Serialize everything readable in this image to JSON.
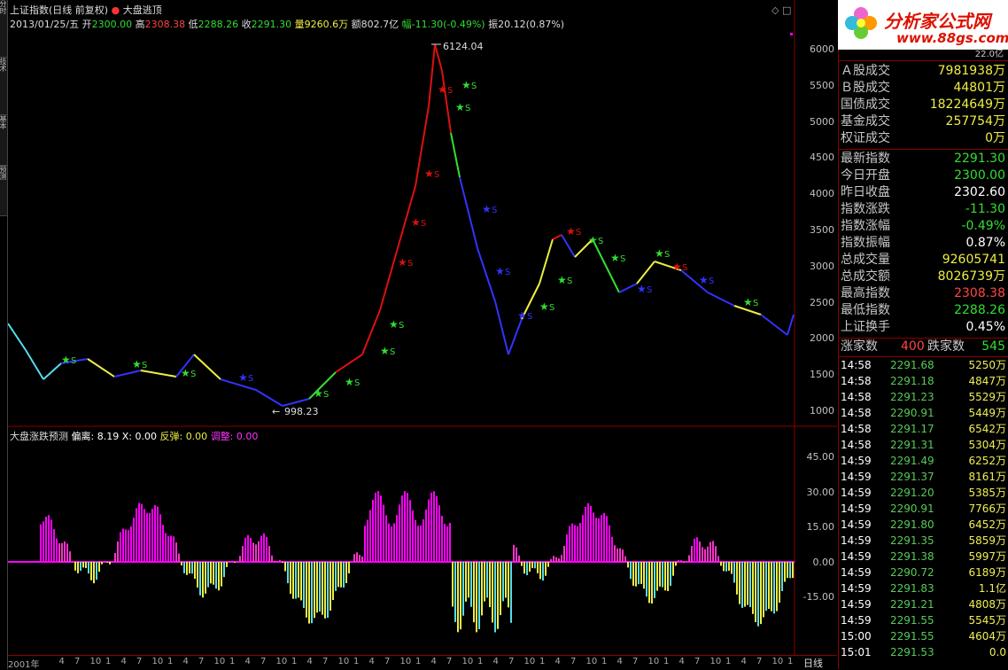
{
  "left_tabs": [
    "分时",
    "技术",
    "基本",
    "预测"
  ],
  "header": {
    "index_name": "上证指数",
    "period": "(日线 前复权)",
    "indicator": "大盘逃顶",
    "date": "2013/01/25/五",
    "open_label": "开",
    "open": "2300.00",
    "high_label": "高",
    "high": "2308.38",
    "low_label": "低",
    "low": "2288.26",
    "close_label": "收",
    "close": "2291.30",
    "vol_label": "量",
    "vol": "9260.6万",
    "amt_label": "额",
    "amt": "802.7亿",
    "chg_label": "幅",
    "chg": "-11.30(-0.49%)",
    "amp_label": "振",
    "amp": "20.12(0.87%)"
  },
  "main_chart": {
    "peak_label": "6124.04",
    "trough_label": "998.23",
    "y_ticks": [
      "6000",
      "5500",
      "5000",
      "4500",
      "4000",
      "3500",
      "3000",
      "2500",
      "2000",
      "1500",
      "1000"
    ],
    "buy_marker": "S"
  },
  "sub_chart": {
    "title": "大盘涨跌预测",
    "dev_label": "偏离:",
    "dev": "8.19",
    "x_label": "X:",
    "x": "0.00",
    "rebound_label": "反弹:",
    "rebound": "0.00",
    "adjust_label": "调整:",
    "adjust": "0.00",
    "y_ticks": [
      "45.00",
      "30.00",
      "15.00",
      "0.00",
      "-15.00"
    ]
  },
  "time_axis": {
    "labels": [
      "2001年",
      "4",
      "7",
      "10",
      "1",
      "4",
      "7",
      "10",
      "1",
      "4",
      "7",
      "10",
      "1",
      "4",
      "7",
      "10",
      "1",
      "4",
      "7",
      "10",
      "1",
      "4",
      "7",
      "10",
      "1",
      "4",
      "7",
      "10",
      "1",
      "4",
      "7",
      "10",
      "1",
      "4",
      "7",
      "10",
      "1",
      "4",
      "7",
      "10",
      "1",
      "4",
      "7",
      "10",
      "1",
      "4",
      "7",
      "10",
      "1"
    ],
    "period_tab": "日线"
  },
  "logo": {
    "name": "分析家公式网",
    "url": "www.88gs.com"
  },
  "panel": {
    "top_value": "22.0亿",
    "trades": [
      {
        "label": "Ａ股成交",
        "value": "7981938万"
      },
      {
        "label": "Ｂ股成交",
        "value": "44801万"
      },
      {
        "label": "国债成交",
        "value": "18224649万"
      },
      {
        "label": "基金成交",
        "value": "257754万"
      },
      {
        "label": "权证成交",
        "value": "0万"
      }
    ],
    "stats": [
      {
        "label": "最新指数",
        "value": "2291.30",
        "color": "#33dd33"
      },
      {
        "label": "今日开盘",
        "value": "2300.00",
        "color": "#33dd33"
      },
      {
        "label": "昨日收盘",
        "value": "2302.60",
        "color": "#ffffff"
      },
      {
        "label": "指数涨跌",
        "value": "-11.30",
        "color": "#33dd33"
      },
      {
        "label": "指数涨幅",
        "value": "-0.49%",
        "color": "#33dd33"
      },
      {
        "label": "指数振幅",
        "value": "0.87%",
        "color": "#ffffff"
      },
      {
        "label": "总成交量",
        "value": "92605741",
        "color": "#eeee44"
      },
      {
        "label": "总成交额",
        "value": "8026739万",
        "color": "#eeee44"
      },
      {
        "label": "最高指数",
        "value": "2308.38",
        "color": "#ff4444"
      },
      {
        "label": "最低指数",
        "value": "2288.26",
        "color": "#33dd33"
      },
      {
        "label": "上证换手",
        "value": "0.45%",
        "color": "#ffffff"
      }
    ],
    "breadth": {
      "up_label": "涨家数",
      "up": "400",
      "down_label": "跌家数",
      "down": "545"
    },
    "ticks": [
      {
        "t": "14:58",
        "p": "2291.68",
        "v": "5250万"
      },
      {
        "t": "14:58",
        "p": "2291.18",
        "v": "4847万"
      },
      {
        "t": "14:58",
        "p": "2291.23",
        "v": "5529万"
      },
      {
        "t": "14:58",
        "p": "2290.91",
        "v": "5449万"
      },
      {
        "t": "14:58",
        "p": "2291.17",
        "v": "6542万"
      },
      {
        "t": "14:58",
        "p": "2291.31",
        "v": "5304万"
      },
      {
        "t": "14:59",
        "p": "2291.49",
        "v": "6252万"
      },
      {
        "t": "14:59",
        "p": "2291.37",
        "v": "8161万"
      },
      {
        "t": "14:59",
        "p": "2291.20",
        "v": "5385万"
      },
      {
        "t": "14:59",
        "p": "2290.91",
        "v": "7766万"
      },
      {
        "t": "14:59",
        "p": "2291.80",
        "v": "6452万"
      },
      {
        "t": "14:59",
        "p": "2291.35",
        "v": "5859万"
      },
      {
        "t": "14:59",
        "p": "2291.38",
        "v": "5997万"
      },
      {
        "t": "14:59",
        "p": "2290.72",
        "v": "6189万"
      },
      {
        "t": "14:59",
        "p": "2291.83",
        "v": "1.1亿"
      },
      {
        "t": "14:59",
        "p": "2291.21",
        "v": "4808万"
      },
      {
        "t": "14:59",
        "p": "2291.55",
        "v": "5545万"
      },
      {
        "t": "15:00",
        "p": "2291.55",
        "v": "4604万"
      },
      {
        "t": "15:01",
        "p": "2291.53",
        "v": "0.0"
      }
    ]
  }
}
